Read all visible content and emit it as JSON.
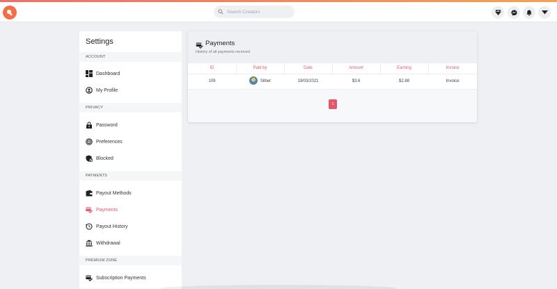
{
  "header": {
    "search_placeholder": "Search Creators"
  },
  "icons": {
    "logo": "logo-icon",
    "search": "search-icon",
    "diamond": "diamond-icon",
    "messenger": "messenger-icon",
    "bell": "bell-icon",
    "dropdown": "caret-down-icon"
  },
  "colors": {
    "accent": "#e4566a",
    "brand": "#f46f47"
  },
  "sidebar": {
    "title": "Settings",
    "sections": [
      {
        "header": "ACCOUNT",
        "items": [
          {
            "label": "Dashboard",
            "icon": "dashboard-icon"
          },
          {
            "label": "My Profile",
            "icon": "profile-icon"
          }
        ]
      },
      {
        "header": "PRIVACY",
        "items": [
          {
            "label": "Password",
            "icon": "lock-icon"
          },
          {
            "label": "Preferences",
            "icon": "target-icon"
          },
          {
            "label": "Blocked",
            "icon": "shield-block-icon"
          }
        ]
      },
      {
        "header": "PAYMENTS",
        "items": [
          {
            "label": "Payout Methods",
            "icon": "wallet-icon"
          },
          {
            "label": "Payments",
            "icon": "payments-icon",
            "active": true
          },
          {
            "label": "Payout History",
            "icon": "history-icon"
          },
          {
            "label": "Withdrawal",
            "icon": "bank-icon"
          }
        ]
      },
      {
        "header": "PREMIUM ZONE",
        "items": [
          {
            "label": "Subscription Payments",
            "icon": "subscription-icon"
          }
        ]
      }
    ]
  },
  "payments": {
    "title": "Payments",
    "subtitle": "History of all payments received",
    "columns": [
      "ID",
      "Paid by",
      "Date",
      "Amount",
      "Earning",
      "Invoice"
    ],
    "rows": [
      {
        "id": "109",
        "paid_by": "Silber",
        "date": "19/03/2021",
        "amount": "$3.6",
        "earning": "$2.88",
        "invoice": "Invoice"
      }
    ],
    "pagination": {
      "current": "1"
    }
  }
}
